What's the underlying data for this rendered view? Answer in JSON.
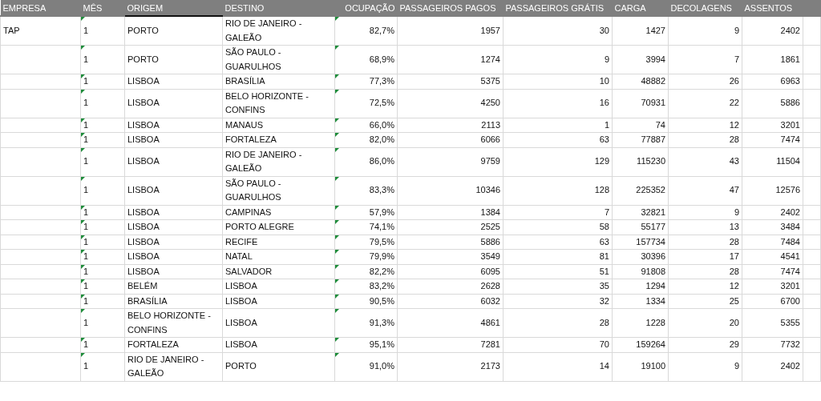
{
  "table": {
    "columns": [
      {
        "label": "EMPRESA",
        "selected": false
      },
      {
        "label": "MÊS",
        "selected": false
      },
      {
        "label": "ORIGEM",
        "selected": true
      },
      {
        "label": "DESTINO",
        "selected": false
      },
      {
        "label": "OCUPAÇÃO",
        "selected": false
      },
      {
        "label": "PASSAGEIROS PAGOS",
        "selected": false
      },
      {
        "label": "PASSAGEIROS GRÁTIS",
        "selected": false
      },
      {
        "label": "CARGA",
        "selected": false
      },
      {
        "label": "DECOLAGENS",
        "selected": false
      },
      {
        "label": "ASSENTOS",
        "selected": false
      }
    ],
    "rows": [
      {
        "empresa": "TAP",
        "mes": "1",
        "origem": "PORTO",
        "destino": "RIO DE JANEIRO - GALEÃO",
        "ocupacao": "82,7%",
        "pagos": "1957",
        "gratis": "30",
        "carga": "1427",
        "decolagens": "9",
        "assentos": "2402"
      },
      {
        "mes": "1",
        "origem": "PORTO",
        "destino": "SÃO PAULO - GUARULHOS",
        "ocupacao": "68,9%",
        "pagos": "1274",
        "gratis": "9",
        "carga": "3994",
        "decolagens": "7",
        "assentos": "1861"
      },
      {
        "mes": "1",
        "origem": "LISBOA",
        "destino": "BRASÍLIA",
        "ocupacao": "77,3%",
        "pagos": "5375",
        "gratis": "10",
        "carga": "48882",
        "decolagens": "26",
        "assentos": "6963"
      },
      {
        "mes": "1",
        "origem": "LISBOA",
        "destino": "BELO HORIZONTE - CONFINS",
        "ocupacao": "72,5%",
        "pagos": "4250",
        "gratis": "16",
        "carga": "70931",
        "decolagens": "22",
        "assentos": "5886"
      },
      {
        "mes": "1",
        "origem": "LISBOA",
        "destino": "MANAUS",
        "ocupacao": "66,0%",
        "pagos": "2113",
        "gratis": "1",
        "carga": "74",
        "decolagens": "12",
        "assentos": "3201"
      },
      {
        "mes": "1",
        "origem": "LISBOA",
        "destino": "FORTALEZA",
        "ocupacao": "82,0%",
        "pagos": "6066",
        "gratis": "63",
        "carga": "77887",
        "decolagens": "28",
        "assentos": "7474"
      },
      {
        "mes": "1",
        "origem": "LISBOA",
        "destino": "RIO DE JANEIRO - GALEÃO",
        "ocupacao": "86,0%",
        "pagos": "9759",
        "gratis": "129",
        "carga": "115230",
        "decolagens": "43",
        "assentos": "11504"
      },
      {
        "mes": "1",
        "origem": "LISBOA",
        "destino": "SÃO PAULO - GUARULHOS",
        "ocupacao": "83,3%",
        "pagos": "10346",
        "gratis": "128",
        "carga": "225352",
        "decolagens": "47",
        "assentos": "12576"
      },
      {
        "mes": "1",
        "origem": "LISBOA",
        "destino": "CAMPINAS",
        "ocupacao": "57,9%",
        "pagos": "1384",
        "gratis": "7",
        "carga": "32821",
        "decolagens": "9",
        "assentos": "2402"
      },
      {
        "mes": "1",
        "origem": "LISBOA",
        "destino": "PORTO ALEGRE",
        "ocupacao": "74,1%",
        "pagos": "2525",
        "gratis": "58",
        "carga": "55177",
        "decolagens": "13",
        "assentos": "3484"
      },
      {
        "mes": "1",
        "origem": "LISBOA",
        "destino": "RECIFE",
        "ocupacao": "79,5%",
        "pagos": "5886",
        "gratis": "63",
        "carga": "157734",
        "decolagens": "28",
        "assentos": "7484"
      },
      {
        "mes": "1",
        "origem": "LISBOA",
        "destino": "NATAL",
        "ocupacao": "79,9%",
        "pagos": "3549",
        "gratis": "81",
        "carga": "30396",
        "decolagens": "17",
        "assentos": "4541"
      },
      {
        "mes": "1",
        "origem": "LISBOA",
        "destino": "SALVADOR",
        "ocupacao": "82,2%",
        "pagos": "6095",
        "gratis": "51",
        "carga": "91808",
        "decolagens": "28",
        "assentos": "7474"
      },
      {
        "mes": "1",
        "origem": "BELÉM",
        "destino": "LISBOA",
        "ocupacao": "83,2%",
        "pagos": "2628",
        "gratis": "35",
        "carga": "1294",
        "decolagens": "12",
        "assentos": "3201"
      },
      {
        "mes": "1",
        "origem": "BRASÍLIA",
        "destino": "LISBOA",
        "ocupacao": "90,5%",
        "pagos": "6032",
        "gratis": "32",
        "carga": "1334",
        "decolagens": "25",
        "assentos": "6700"
      },
      {
        "mes": "1",
        "origem": "BELO HORIZONTE - CONFINS",
        "destino": "LISBOA",
        "ocupacao": "91,3%",
        "pagos": "4861",
        "gratis": "28",
        "carga": "1228",
        "decolagens": "20",
        "assentos": "5355"
      },
      {
        "mes": "1",
        "origem": "FORTALEZA",
        "destino": "LISBOA",
        "ocupacao": "95,1%",
        "pagos": "7281",
        "gratis": "70",
        "carga": "159264",
        "decolagens": "29",
        "assentos": "7732"
      },
      {
        "mes": "1",
        "origem": "RIO DE JANEIRO - GALEÃO",
        "destino": "PORTO",
        "ocupacao": "91,0%",
        "pagos": "2173",
        "gratis": "14",
        "carga": "19100",
        "decolagens": "9",
        "assentos": "2402"
      }
    ]
  }
}
